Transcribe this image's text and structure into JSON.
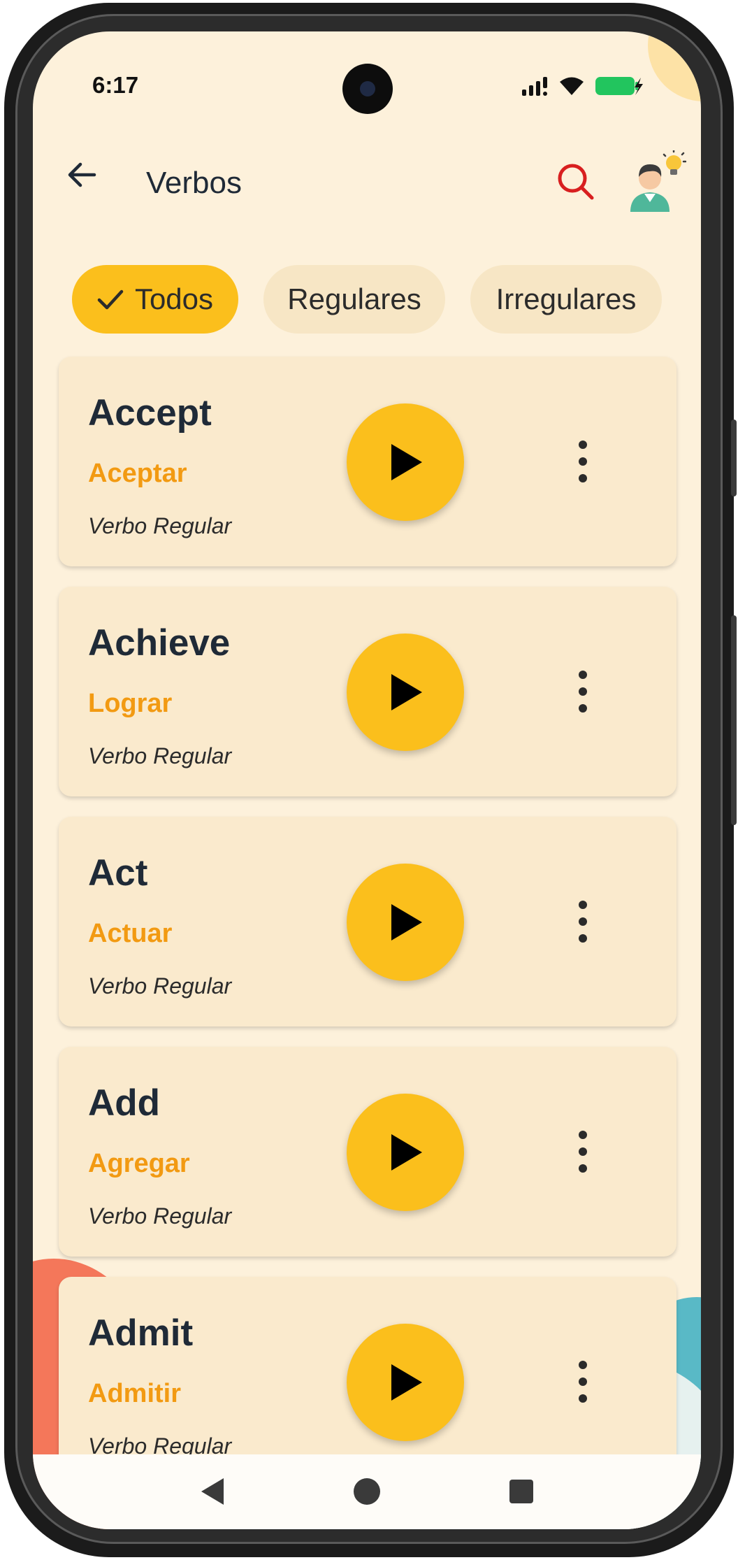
{
  "status_bar": {
    "time": "6:17",
    "icons": [
      "signal-icon",
      "wifi-icon",
      "battery-charging-icon"
    ],
    "battery_color": "#22c55e"
  },
  "app_bar": {
    "back_icon": "arrow-left-icon",
    "title": "Verbos",
    "search_icon": "search-icon",
    "search_color": "#d81f1f",
    "avatar_icon": "teacher-idea-avatar-icon"
  },
  "filters": {
    "chips": [
      {
        "label": "Todos",
        "selected": true
      },
      {
        "label": "Regulares",
        "selected": false
      },
      {
        "label": "Irregulares",
        "selected": false
      }
    ],
    "selected_color": "#fbbf1c"
  },
  "verbs": [
    {
      "word": "Accept",
      "translation": "Aceptar",
      "type": "Verbo Regular"
    },
    {
      "word": "Achieve",
      "translation": "Lograr",
      "type": "Verbo Regular"
    },
    {
      "word": "Act",
      "translation": "Actuar",
      "type": "Verbo Regular"
    },
    {
      "word": "Add",
      "translation": "Agregar",
      "type": "Verbo Regular"
    },
    {
      "word": "Admit",
      "translation": "Admitir",
      "type": "Verbo Regular"
    }
  ],
  "colors": {
    "background": "#fdf1db",
    "card": "#faeacd",
    "accent": "#fbbf1c",
    "translation": "#f29a12"
  },
  "nav_bar": {
    "icons": [
      "back-triangle-icon",
      "home-circle-icon",
      "recents-square-icon"
    ]
  }
}
